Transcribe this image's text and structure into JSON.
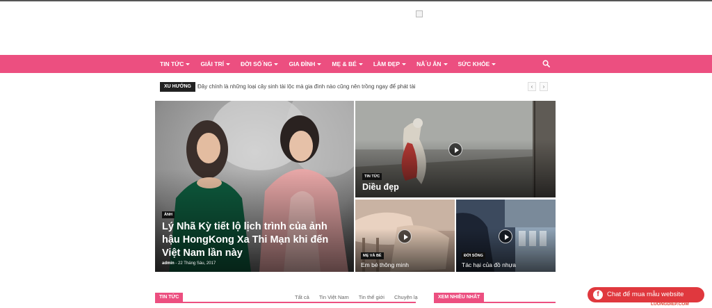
{
  "nav": {
    "items": [
      {
        "label": "TIN TỨC"
      },
      {
        "label": "GIẢI TRÍ"
      },
      {
        "label": "ĐỜI SỐ ́NG"
      },
      {
        "label": "GIA ĐÌNH"
      },
      {
        "label": "MẸ & BÉ"
      },
      {
        "label": "LÀM ĐẸP"
      },
      {
        "label": "NÂ ́U ĂN"
      },
      {
        "label": "SỨC KHỎE"
      }
    ],
    "search_icon": "search-icon"
  },
  "trending": {
    "label": "XU HƯỚNG",
    "text": "Đây chính là những loại cây sinh tài lộc mà gia đình nào cũng nên trồng ngay để phát tài",
    "prev": "‹",
    "next": "›"
  },
  "featured": {
    "main": {
      "tag": "ẢNH",
      "title": "Lý Nhã Kỳ tiết lộ lịch trình của ảnh hậu HongKong Xa Thi Mạn khi đến Việt Nam lần này",
      "author": "admin",
      "date": "- 22 Tháng Sáu, 2017"
    },
    "top_right": {
      "tag": "TIN TỨC",
      "title": "Diều đẹp"
    },
    "bottom_left": {
      "tag": "MẸ VÀ BÉ",
      "title": "Em bé thông minh"
    },
    "bottom_right": {
      "tag": "ĐỜI SỐNG",
      "title": "Tác hại của đồ nhựa"
    }
  },
  "sections": {
    "news": {
      "title": "TIN TỨC",
      "tabs": [
        "Tất cả",
        "Tin Việt Nam",
        "Tin thế giới",
        "Chuyện lạ"
      ]
    },
    "popular": {
      "title": "XEM NHIỀU NHẤT"
    }
  },
  "chat": {
    "label": "Chat để mua mẫu website",
    "icon": "facebook-icon"
  },
  "watermark": "LUONGDIEP.COM",
  "colors": {
    "accent": "#ec4f80",
    "chat": "#e0383e"
  }
}
